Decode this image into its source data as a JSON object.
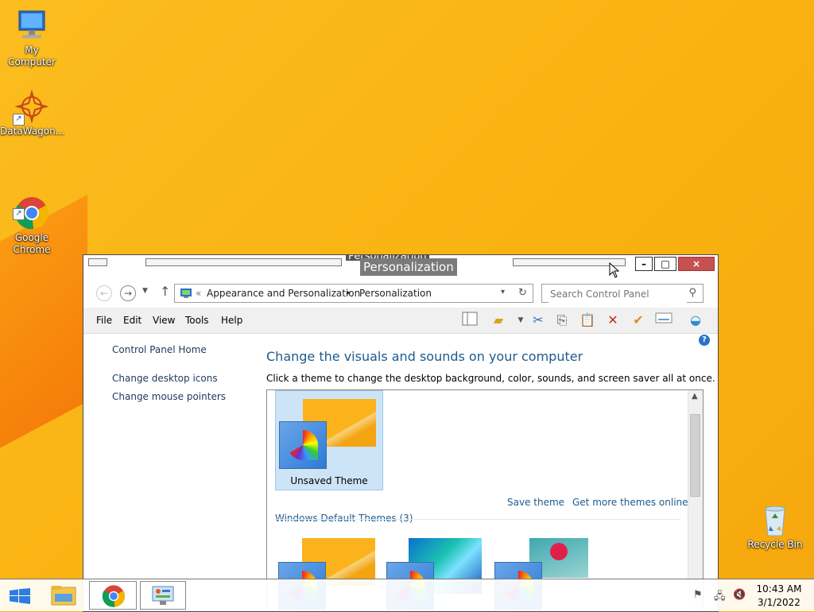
{
  "desktop": {
    "icons": [
      {
        "label": "My Computer"
      },
      {
        "label": "DataWagon..."
      },
      {
        "label": "Google\nChrome"
      },
      {
        "label": "Recycle Bin"
      }
    ]
  },
  "window": {
    "title": "Personalization",
    "title_ghost": "Personalization",
    "close_glyph": "×",
    "minimize_glyph": "–",
    "maximize_glyph": "□",
    "address": {
      "chevrons": "«",
      "crumb1": "Appearance and Personalization",
      "separator": "▸",
      "crumb2": "Personalization"
    },
    "search": {
      "placeholder": "Search Control Panel"
    },
    "menu": [
      "File",
      "Edit",
      "View",
      "Tools",
      "Help"
    ],
    "sidebar": {
      "home": "Control Panel Home",
      "links": [
        "Change desktop icons",
        "Change mouse pointers"
      ]
    },
    "heading": "Change the visuals and sounds on your computer",
    "subheading": "Click a theme to change the desktop background, color, sounds, and screen saver all at once.",
    "themes": {
      "current": "Unsaved Theme",
      "save_theme": "Save theme",
      "get_more": "Get more themes online",
      "section": "Windows Default Themes (3)"
    }
  },
  "taskbar": {
    "time": "10:43 AM",
    "date": "3/1/2022"
  },
  "colors": {
    "accent": "#1e5a8c",
    "link": "#1e395b",
    "desktop": "#f9b514",
    "close": "#c75050"
  }
}
